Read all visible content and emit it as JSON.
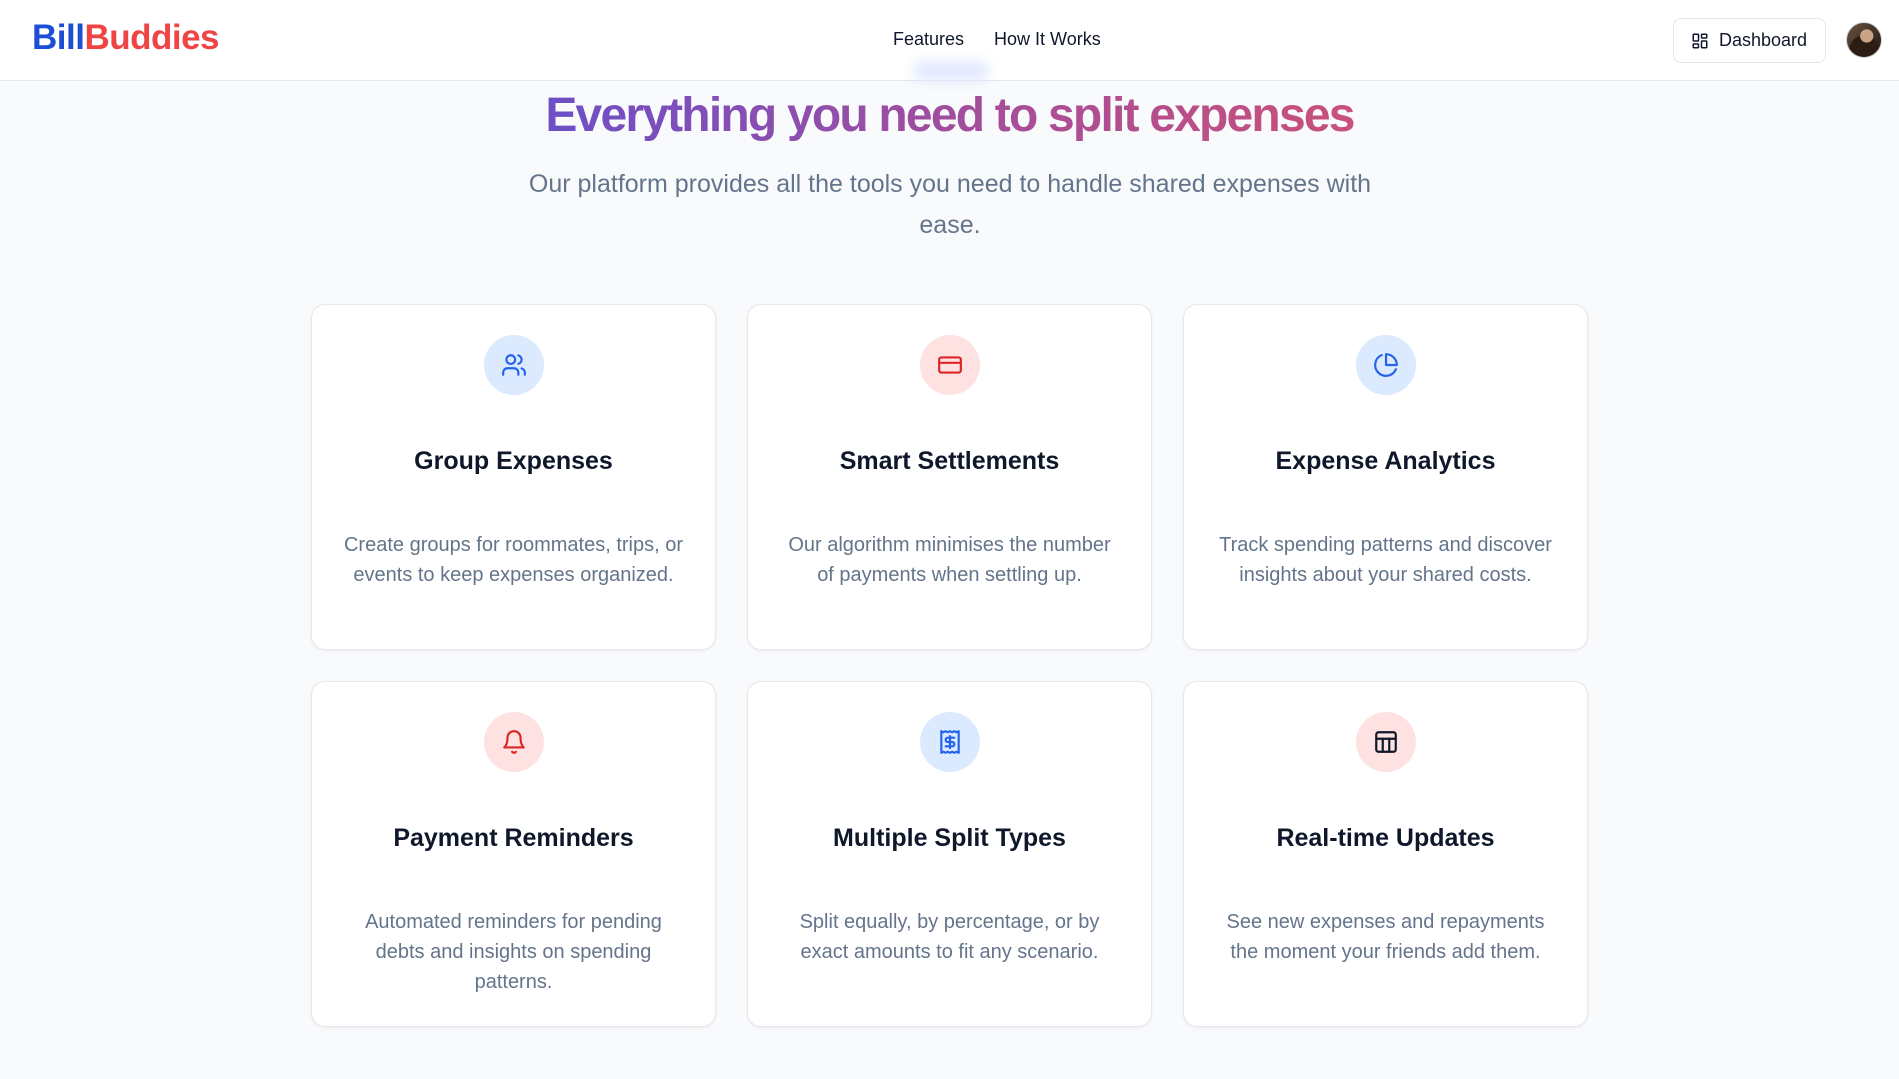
{
  "header": {
    "logo_part1": "Bill",
    "logo_part2": "Buddies",
    "nav": [
      "Features",
      "How It Works"
    ],
    "dashboard_label": "Dashboard"
  },
  "hero": {
    "title": "Everything you need to split expenses",
    "subtitle": "Our platform provides all the tools you need to handle shared expenses with ease."
  },
  "features": [
    {
      "icon": "users-icon",
      "accent": "#2563eb",
      "title": "Group Expenses",
      "description": "Create groups for roommates, trips, or events to keep expenses organized."
    },
    {
      "icon": "credit-card-icon",
      "accent": "#dc2626",
      "title": "Smart Settlements",
      "description": "Our algorithm minimises the number of payments when settling up."
    },
    {
      "icon": "pie-chart-icon",
      "accent": "#2563eb",
      "title": "Expense Analytics",
      "description": "Track spending patterns and discover insights about your shared costs."
    },
    {
      "icon": "bell-icon",
      "accent": "#dc2626",
      "title": "Payment Reminders",
      "description": "Automated reminders for pending debts and insights on spending patterns."
    },
    {
      "icon": "receipt-icon",
      "accent": "#2563eb",
      "title": "Multiple Split Types",
      "description": "Split equally, by percentage, or by exact amounts to fit any scenario."
    },
    {
      "icon": "calculator-icon",
      "accent": "#0f172a",
      "title": "Real-time Updates",
      "description": "See new expenses and repayments the moment your friends add them."
    }
  ]
}
